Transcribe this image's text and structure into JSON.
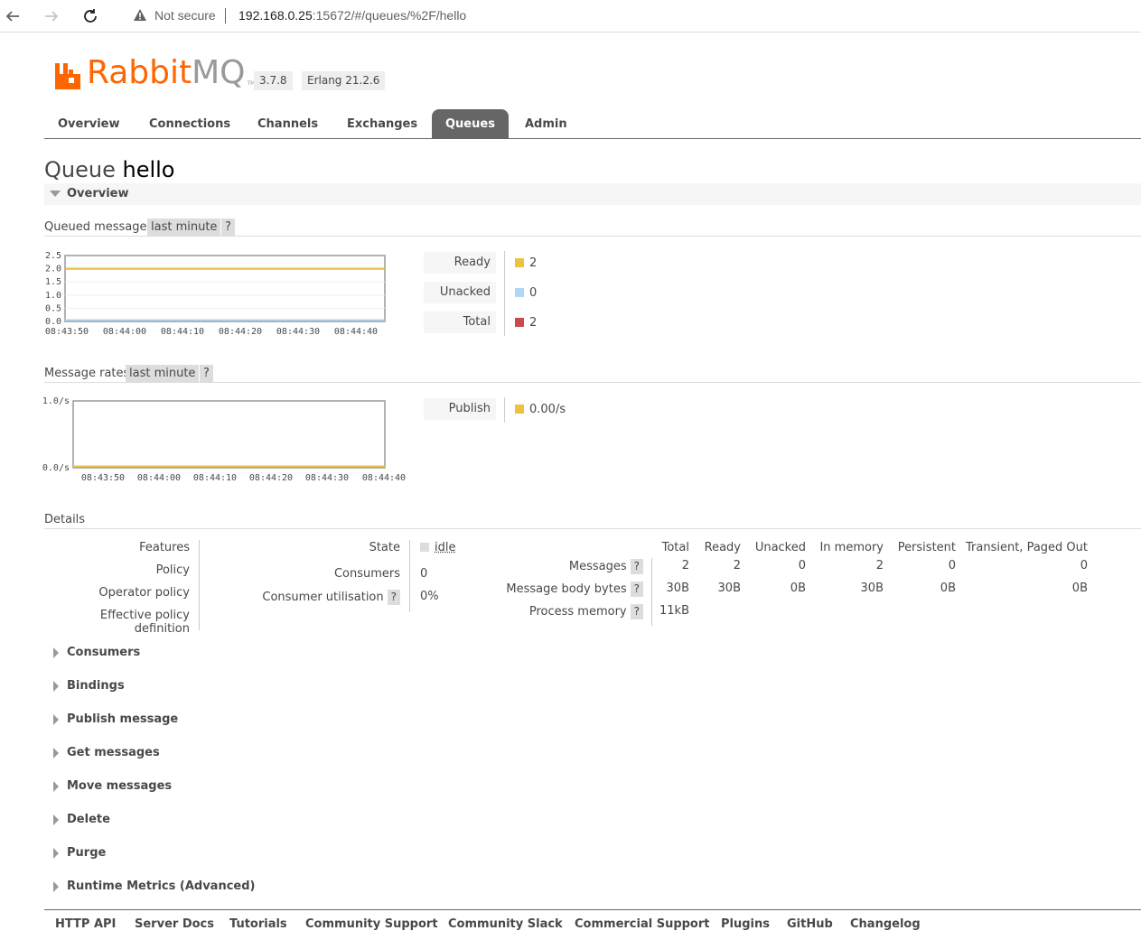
{
  "browser": {
    "security": "Not secure",
    "url_host": "192.168.0.25",
    "url_rest": ":15672/#/queues/%2F/hello"
  },
  "header": {
    "logo_rabbit": "Rabbit",
    "logo_mq": "MQ",
    "logo_tm": "TM",
    "version": "3.7.8",
    "erlang": "Erlang 21.2.6",
    "brand_color": "#ff6600"
  },
  "tabs": [
    {
      "label": "Overview"
    },
    {
      "label": "Connections"
    },
    {
      "label": "Channels"
    },
    {
      "label": "Exchanges"
    },
    {
      "label": "Queues",
      "active": true
    },
    {
      "label": "Admin"
    }
  ],
  "page": {
    "title_prefix": "Queue",
    "title_name": "hello",
    "overview_label": "Overview"
  },
  "queued": {
    "label": "Queued messages",
    "range": "last minute",
    "help": "?",
    "legend": [
      {
        "name": "Ready",
        "value": "2",
        "color": "#edc240"
      },
      {
        "name": "Unacked",
        "value": "0",
        "color": "#afd8f8"
      },
      {
        "name": "Total",
        "value": "2",
        "color": "#cb4b4b"
      }
    ]
  },
  "rates": {
    "label": "Message rates",
    "range": "last minute",
    "help": "?",
    "legend": [
      {
        "name": "Publish",
        "value": "0.00/s",
        "color": "#edc240"
      }
    ]
  },
  "chart_data": [
    {
      "type": "line",
      "x": [
        "08:43:50",
        "08:44:00",
        "08:44:10",
        "08:44:20",
        "08:44:30",
        "08:44:40"
      ],
      "yticks": [
        "2.5",
        "2.0",
        "1.5",
        "1.0",
        "0.5",
        "0.0"
      ],
      "ylim": [
        0,
        2.5
      ],
      "series": [
        {
          "name": "Ready",
          "values": [
            2,
            2,
            2,
            2,
            2,
            2
          ],
          "color": "#edc240"
        },
        {
          "name": "Unacked",
          "values": [
            0,
            0,
            0,
            0,
            0,
            0
          ],
          "color": "#afd8f8"
        },
        {
          "name": "Total",
          "values": [
            2,
            2,
            2,
            2,
            2,
            2
          ],
          "color": "#cb4b4b"
        }
      ]
    },
    {
      "type": "line",
      "x": [
        "08:43:50",
        "08:44:00",
        "08:44:10",
        "08:44:20",
        "08:44:30",
        "08:44:40"
      ],
      "yticks": [
        "1.0/s",
        "0.0/s"
      ],
      "ylim": [
        0,
        1.0
      ],
      "series": [
        {
          "name": "Publish",
          "values": [
            0,
            0,
            0,
            0,
            0,
            0
          ],
          "color": "#edc240"
        }
      ]
    }
  ],
  "details": {
    "label": "Details",
    "left_keys": [
      "Features",
      "Policy",
      "Operator policy",
      "Effective policy definition"
    ],
    "state_key": "State",
    "state_value": "idle",
    "consumers_key": "Consumers",
    "consumers_value": "0",
    "util_key": "Consumer utilisation",
    "util_value": "0%",
    "help": "?",
    "table": {
      "headers": [
        "Total",
        "Ready",
        "Unacked",
        "In memory",
        "Persistent",
        "Transient, Paged Out"
      ],
      "rows": [
        {
          "label": "Messages",
          "cells": [
            "2",
            "2",
            "0",
            "2",
            "0",
            "0"
          ]
        },
        {
          "label": "Message body bytes",
          "cells": [
            "30B",
            "30B",
            "0B",
            "30B",
            "0B",
            "0B"
          ]
        },
        {
          "label": "Process memory",
          "cells": [
            "11kB",
            "",
            "",
            "",
            "",
            ""
          ]
        }
      ]
    }
  },
  "sections": [
    "Consumers",
    "Bindings",
    "Publish message",
    "Get messages",
    "Move messages",
    "Delete",
    "Purge",
    "Runtime Metrics (Advanced)"
  ],
  "footer": [
    "HTTP API",
    "Server Docs",
    "Tutorials",
    "Community Support",
    "Community Slack",
    "Commercial Support",
    "Plugins",
    "GitHub",
    "Changelog"
  ]
}
